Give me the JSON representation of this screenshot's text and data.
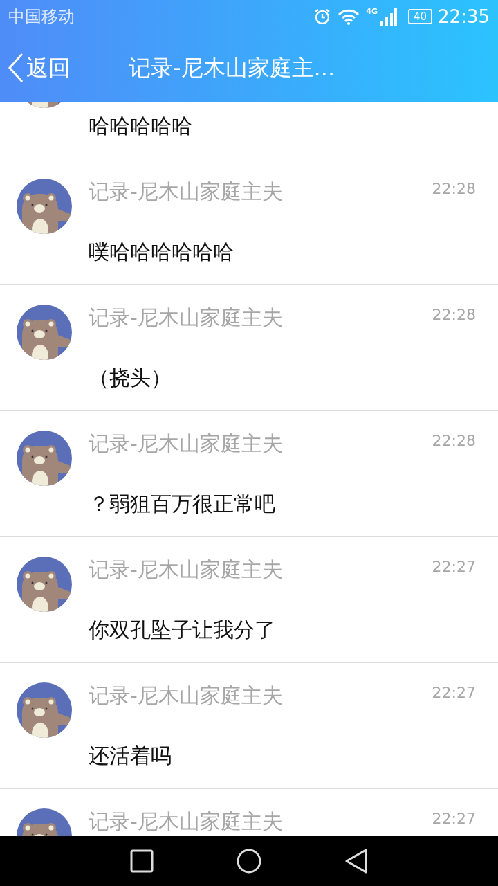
{
  "status_bar": {
    "carrier": "中国移动",
    "network": "4G",
    "battery": "40",
    "time": "22:35"
  },
  "header": {
    "back": "返回",
    "title": "记录-尼木山家庭主..."
  },
  "messages": [
    {
      "text": "哈哈哈哈哈"
    },
    {
      "sender": "记录-尼木山家庭主夫",
      "time": "22:28",
      "text": "噗哈哈哈哈哈哈"
    },
    {
      "sender": "记录-尼木山家庭主夫",
      "time": "22:28",
      "text": "（挠头）"
    },
    {
      "sender": "记录-尼木山家庭主夫",
      "time": "22:28",
      "text": "？弱狙百万很正常吧"
    },
    {
      "sender": "记录-尼木山家庭主夫",
      "time": "22:27",
      "text": "你双孔坠子让我分了"
    },
    {
      "sender": "记录-尼木山家庭主夫",
      "time": "22:27",
      "text": "还活着吗"
    },
    {
      "sender": "记录-尼木山家庭主夫",
      "time": "22:27"
    }
  ]
}
